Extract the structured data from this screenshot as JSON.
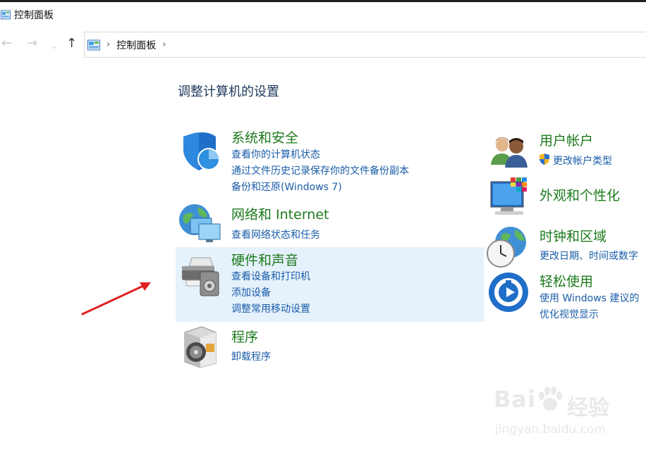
{
  "window": {
    "title": "控制面板"
  },
  "nav": {
    "back_icon": "←",
    "forward_icon": "→",
    "dropdown_icon": "⌄",
    "up_icon": "↑"
  },
  "address": {
    "separator": "›",
    "crumb": "控制面板",
    "trailing_separator": "›"
  },
  "page": {
    "title": "调整计算机的设置"
  },
  "categories_left": [
    {
      "title": "系统和安全",
      "links": [
        "查看你的计算机状态",
        "通过文件历史记录保存你的文件备份副本",
        "备份和还原(Windows 7)"
      ]
    },
    {
      "title": "网络和 Internet",
      "links": [
        "查看网络状态和任务"
      ]
    },
    {
      "title": "硬件和声音",
      "links": [
        "查看设备和打印机",
        "添加设备",
        "调整常用移动设置"
      ]
    },
    {
      "title": "程序",
      "links": [
        "卸载程序"
      ]
    }
  ],
  "categories_right": [
    {
      "title": "用户帐户",
      "links": [
        "更改帐户类型"
      ]
    },
    {
      "title": "外观和个性化",
      "links": []
    },
    {
      "title": "时钟和区域",
      "links": [
        "更改日期、时间或数字"
      ]
    },
    {
      "title": "轻松使用",
      "links": [
        "使用 Windows 建议的",
        "优化视觉显示"
      ]
    }
  ],
  "watermark": {
    "brand_left": "Bai",
    "brand_right": "经验",
    "url": "jingyan.baidu.com"
  },
  "colors": {
    "category_title": "#1d7a1d",
    "link": "#1a5da8",
    "hover": "#e5f1fb",
    "arrow": "#e02020"
  }
}
